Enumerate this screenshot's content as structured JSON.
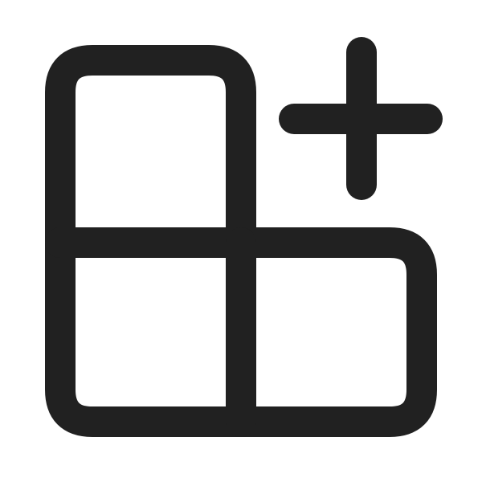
{
  "icon": {
    "name": "add-apps-icon",
    "stroke_color": "#212121",
    "background_color": "#ffffff"
  }
}
